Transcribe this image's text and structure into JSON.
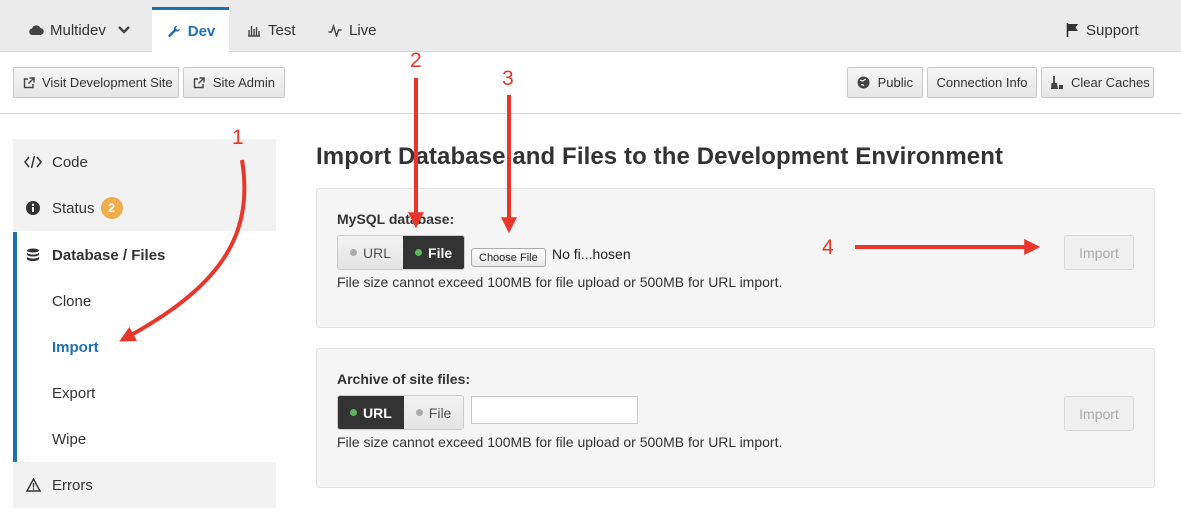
{
  "tabs": {
    "multidev": "Multidev",
    "dev": "Dev",
    "test": "Test",
    "live": "Live",
    "support": "Support"
  },
  "toolbar": {
    "visit_site": "Visit Development Site",
    "site_admin": "Site Admin",
    "public": "Public",
    "connection_info": "Connection Info",
    "clear_caches": "Clear Caches"
  },
  "sidebar": {
    "code": "Code",
    "status": "Status",
    "status_badge": "2",
    "database_files": "Database / Files",
    "clone": "Clone",
    "import": "Import",
    "export": "Export",
    "wipe": "Wipe",
    "errors": "Errors"
  },
  "main": {
    "title": "Import Database and Files to the Development Environment",
    "mysql": {
      "label": "MySQL database:",
      "url": "URL",
      "file": "File",
      "selected": "File",
      "choose_file": "Choose File",
      "file_status": "No fi...hosen",
      "help": "File size cannot exceed 100MB for file upload or 500MB for URL import.",
      "import": "Import"
    },
    "archive": {
      "label": "Archive of site files:",
      "url": "URL",
      "file": "File",
      "selected": "URL",
      "url_value": "",
      "help": "File size cannot exceed 100MB for file upload or 500MB for URL import.",
      "import": "Import"
    }
  },
  "annotations": [
    "1",
    "2",
    "3",
    "4"
  ],
  "colors": {
    "accent": "#1f6fb2",
    "annotation": "#e8362a",
    "badge": "#f0ad4e",
    "active_dot": "#5cb85c"
  }
}
